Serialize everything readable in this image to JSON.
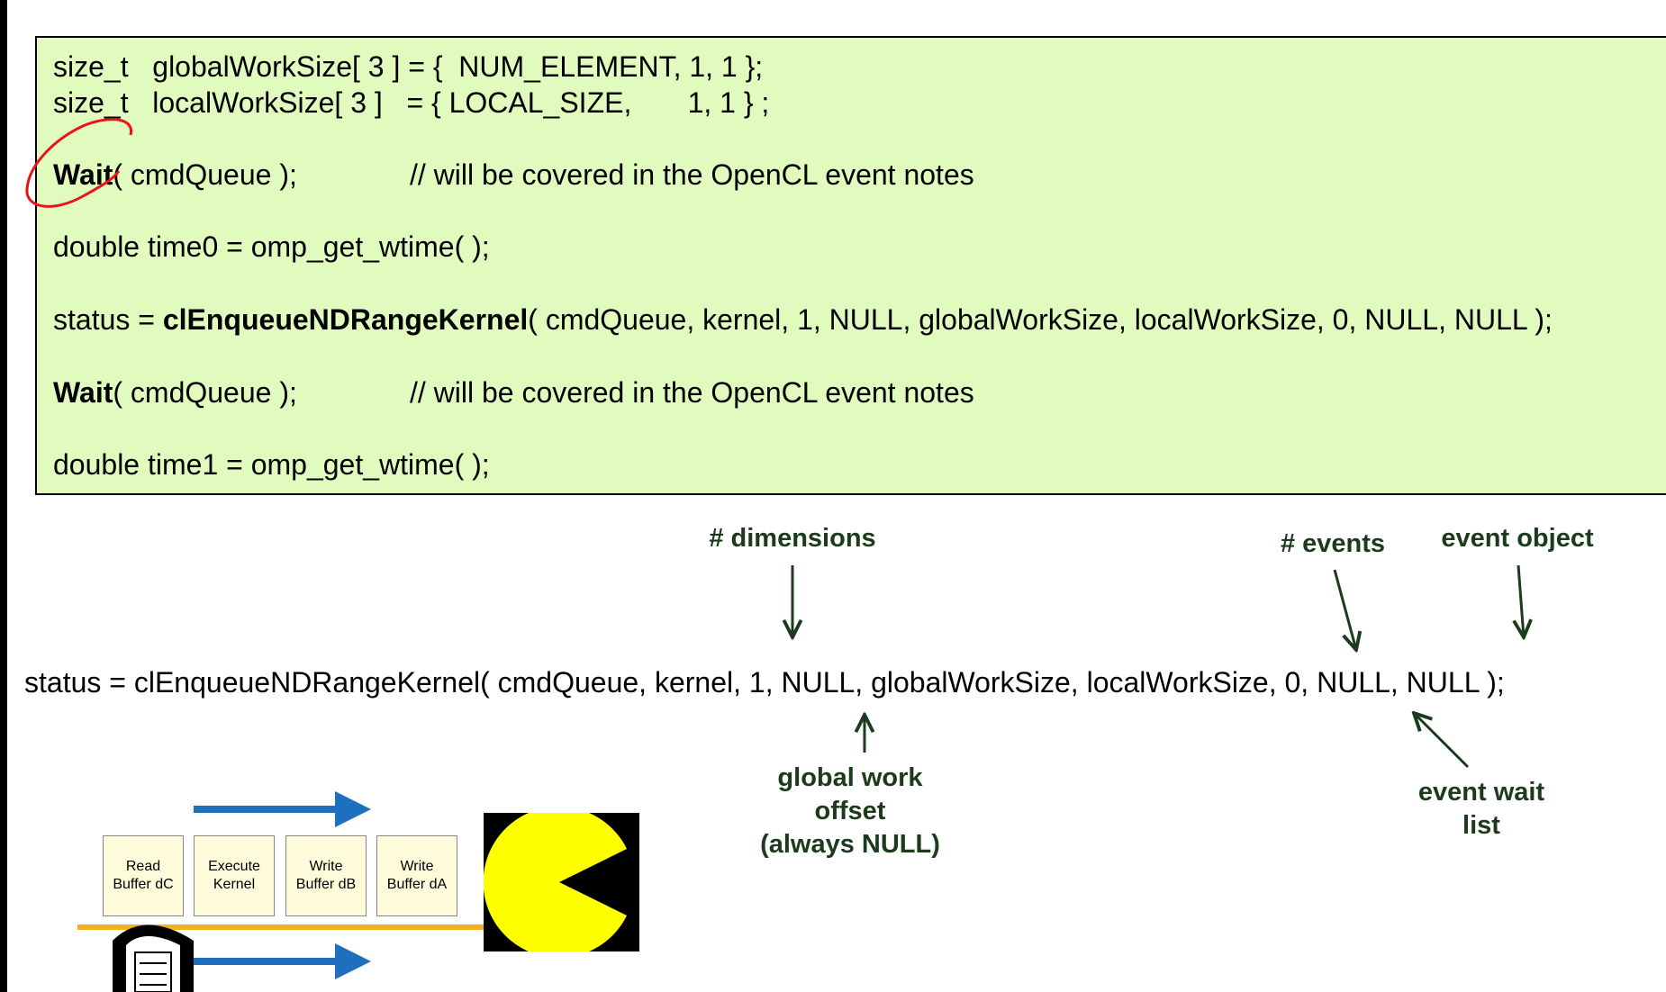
{
  "code": {
    "line1": {
      "type": "size_t",
      "rest": "globalWorkSize[ 3 ] = {  NUM_ELEMENT, 1, 1 };"
    },
    "line2": {
      "type": "size_t",
      "rest": "localWorkSize[ 3 ]   = { LOCAL_SIZE,       1, 1 } ;"
    },
    "wait1": {
      "fn": "Wait",
      "args": "( cmdQueue );",
      "comment": "// will be covered in the OpenCL event notes"
    },
    "time0": "double time0 = omp_get_wtime( );",
    "enqueue": {
      "prefix": "status = ",
      "fn": "clEnqueueNDRangeKernel",
      "args": "( cmdQueue, kernel, 1, NULL, globalWorkSize, localWorkSize, 0, NULL, NULL );"
    },
    "wait2": {
      "fn": "Wait",
      "args": "( cmdQueue );",
      "comment": "// will be covered in the OpenCL event notes"
    },
    "time1": "double time1 = omp_get_wtime( );"
  },
  "call_line": "status = clEnqueueNDRangeKernel( cmdQueue, kernel, 1, NULL, globalWorkSize, localWorkSize, 0, NULL, NULL );",
  "annotations": {
    "dimensions": "# dimensions",
    "events": "# events",
    "event_object": "event object",
    "global_work_offset": "global work\noffset\n(always NULL)",
    "event_wait_list": "event wait\nlist"
  },
  "queue": [
    {
      "line1": "Read",
      "line2": "Buffer dC"
    },
    {
      "line1": "Execute",
      "line2": "Kernel"
    },
    {
      "line1": "Write",
      "line2": "Buffer dB"
    },
    {
      "line1": "Write",
      "line2": "Buffer dA"
    }
  ],
  "colors": {
    "code_bg": "#e0fbbd",
    "annotation": "#1c3a1c",
    "circle_mark": "#e8141b",
    "blue_arrow": "#1f6fbf",
    "queue_line": "#f2b21b",
    "pacman": "#ffff00"
  },
  "icons": {
    "pacman": "pacman-icon",
    "seal": "university-seal-icon"
  }
}
